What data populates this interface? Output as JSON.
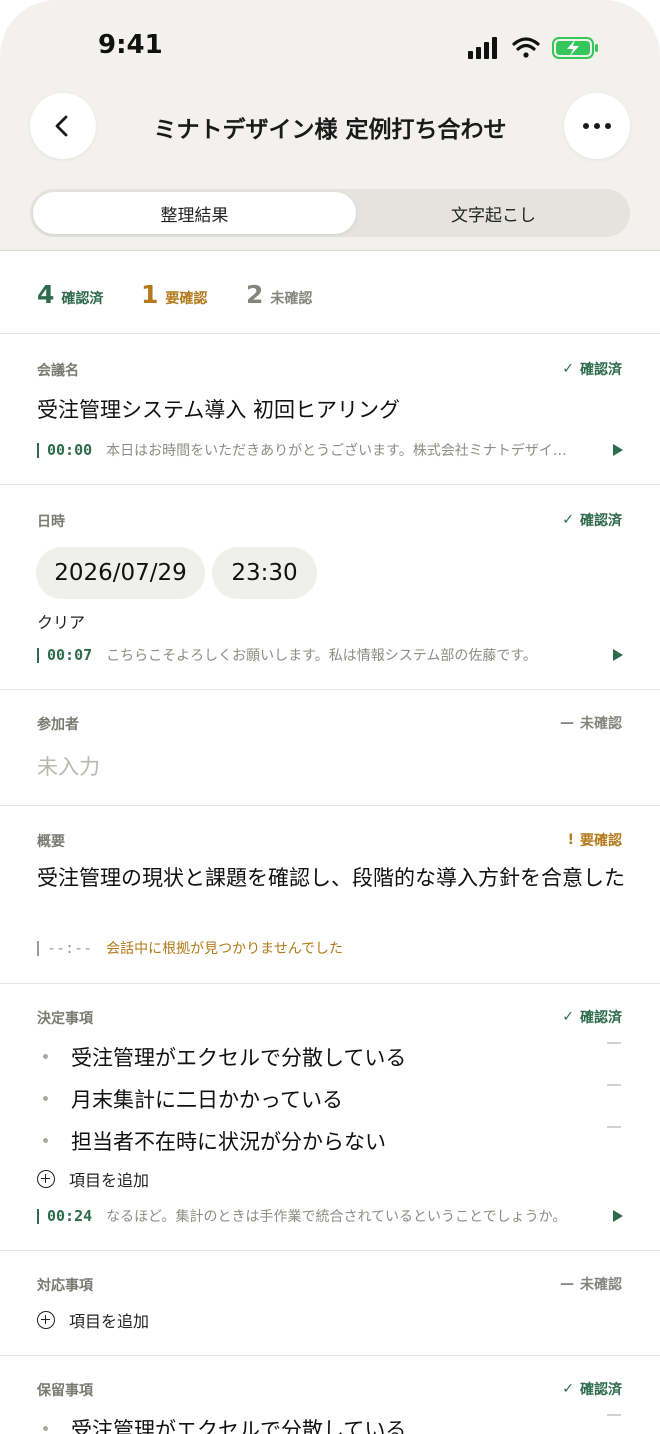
{
  "status_bar": {
    "time": "9:41"
  },
  "header": {
    "title": "ミナトデザイン様 定例打ち合わせ"
  },
  "tabs": [
    {
      "label": "整理結果",
      "active": true
    },
    {
      "label": "文字起こし",
      "active": false
    }
  ],
  "summary": {
    "confirmed": {
      "count": "4",
      "label": "確認済"
    },
    "needs_review": {
      "count": "1",
      "label": "要確認"
    },
    "unconfirmed": {
      "count": "2",
      "label": "未確認"
    }
  },
  "sections": {
    "meeting_name": {
      "label": "会議名",
      "status": "確認済",
      "value": "受注管理システム導入 初回ヒアリング",
      "quote": {
        "time": "00:00",
        "text": "本日はお時間をいただきありがとうございます。株式会社ミナトデザインの"
      }
    },
    "datetime": {
      "label": "日時",
      "status": "確認済",
      "date": "2026/07/29",
      "time": "23:30",
      "clear": "クリア",
      "quote": {
        "time": "00:07",
        "text": "こちらこそよろしくお願いします。私は情報システム部の佐藤です。"
      }
    },
    "participants": {
      "label": "参加者",
      "status": "未確認",
      "placeholder": "未入力"
    },
    "overview": {
      "label": "概要",
      "status": "要確認",
      "value": "受注管理の現状と課題を確認し、段階的な導入方針を合意した",
      "quote": {
        "time": "--:--",
        "text": "会話中に根拠が見つかりませんでした"
      }
    },
    "decisions": {
      "label": "決定事項",
      "status": "確認済",
      "items": [
        "受注管理がエクセルで分散している",
        "月末集計に二日かかっている",
        "担当者不在時に状況が分からない"
      ],
      "add_label": "項目を追加",
      "quote": {
        "time": "00:24",
        "text": "なるほど。集計のときは手作業で統合されているということでしょうか。"
      }
    },
    "actions": {
      "label": "対応事項",
      "status": "未確認",
      "add_label": "項目を追加"
    },
    "pending": {
      "label": "保留事項",
      "status": "確認済",
      "items": [
        "受注管理がエクセルで分散している"
      ]
    }
  },
  "colors": {
    "confirmed": "#2e6b4d",
    "needs_review": "#b27a1b",
    "unconfirmed": "#858580",
    "background": "#f2f1ed"
  }
}
